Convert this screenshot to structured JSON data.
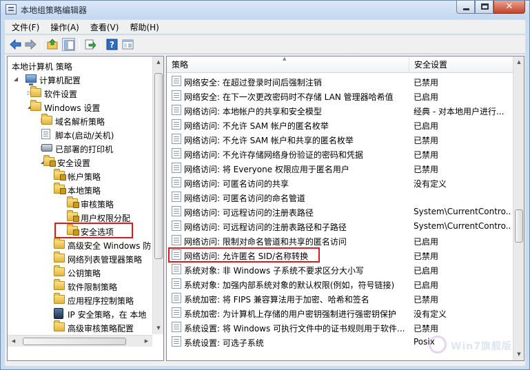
{
  "window": {
    "title": "本地组策略编辑器",
    "buttons": {
      "close_glyph": "✕"
    }
  },
  "menu": [
    "文件(F)",
    "操作(A)",
    "查看(V)",
    "帮助(H)"
  ],
  "toolbar": {
    "buttons": [
      "back-icon",
      "forward-icon",
      "up-folder-icon",
      "show-hide-tree-icon",
      "export-list-icon",
      "help-icon",
      "properties-icon"
    ]
  },
  "tree": {
    "items": [
      {
        "label": "本地计算机 策略",
        "icon": "none"
      },
      {
        "label": "计算机配置",
        "icon": "computer-icon",
        "expander": "◢"
      },
      {
        "label": "软件设置",
        "icon": "folder-icon",
        "expander": "▷"
      },
      {
        "label": "Windows 设置",
        "icon": "folder-icon",
        "expander": "◢"
      },
      {
        "label": "域名解析策略",
        "icon": "folder-icon",
        "expander": "▷"
      },
      {
        "label": "脚本(启动/关机)",
        "icon": "document-icon",
        "expander": ""
      },
      {
        "label": "已部署的打印机",
        "icon": "printer-icon",
        "expander": "▷"
      },
      {
        "label": "安全设置",
        "icon": "security-folder-icon",
        "expander": "◢"
      },
      {
        "label": "帐户策略",
        "icon": "security-folder-icon",
        "expander": "▷"
      },
      {
        "label": "本地策略",
        "icon": "security-folder-icon",
        "expander": "◢"
      },
      {
        "label": "审核策略",
        "icon": "security-folder-icon",
        "expander": "▷"
      },
      {
        "label": "用户权限分配",
        "icon": "security-folder-icon",
        "expander": ""
      },
      {
        "label": "安全选项",
        "icon": "security-folder-icon",
        "expander": "▷"
      },
      {
        "label": "高级安全 Windows 防",
        "icon": "folder-icon",
        "expander": "▷"
      },
      {
        "label": "网络列表管理器策略",
        "icon": "folder-icon",
        "expander": ""
      },
      {
        "label": "公钥策略",
        "icon": "folder-icon",
        "expander": "▷"
      },
      {
        "label": "软件限制策略",
        "icon": "folder-icon",
        "expander": "▷"
      },
      {
        "label": "应用程序控制策略",
        "icon": "folder-icon",
        "expander": "▷"
      },
      {
        "label": "IP 安全策略，在 本地",
        "icon": "ip-security-icon",
        "expander": "▷"
      },
      {
        "label": "高级审核策略配置",
        "icon": "folder-icon",
        "expander": "▷"
      }
    ]
  },
  "list": {
    "columns": {
      "policy": "策略",
      "setting": "安全设置"
    },
    "rows": [
      {
        "policy": "网络安全: 在超过登录时间后强制注销",
        "setting": "已禁用"
      },
      {
        "policy": "网络安全: 在下一次更改密码时不存储 LAN 管理器哈希值",
        "setting": "已启用"
      },
      {
        "policy": "网络访问: 本地帐户的共享和安全模型",
        "setting": "经典 - 对本地用户进行..."
      },
      {
        "policy": "网络访问: 不允许 SAM 帐户的匿名枚举",
        "setting": "已启用"
      },
      {
        "policy": "网络访问: 不允许 SAM 帐户和共享的匿名枚举",
        "setting": "已禁用"
      },
      {
        "policy": "网络访问: 不允许存储网络身份验证的密码和凭据",
        "setting": "已禁用"
      },
      {
        "policy": "网络访问: 将 Everyone 权限应用于匿名用户",
        "setting": "已禁用"
      },
      {
        "policy": "网络访问: 可匿名访问的共享",
        "setting": "没有定义"
      },
      {
        "policy": "网络访问: 可匿名访问的命名管道",
        "setting": ""
      },
      {
        "policy": "网络访问: 可远程访问的注册表路径",
        "setting": "System\\CurrentContro..."
      },
      {
        "policy": "网络访问: 可远程访问的注册表路径和子路径",
        "setting": "System\\CurrentContro..."
      },
      {
        "policy": "网络访问: 限制对命名管道和共享的匿名访问",
        "setting": "已启用"
      },
      {
        "policy": "网络访问: 允许匿名 SID/名称转换",
        "setting": "已禁用"
      },
      {
        "policy": "系统对象: 非 Windows 子系统不要求区分大小写",
        "setting": "已启用"
      },
      {
        "policy": "系统对象: 加强内部系统对象的默认权限(例如，符号链接)",
        "setting": "已启用"
      },
      {
        "policy": "系统加密: 将 FIPS 兼容算法用于加密、哈希和签名",
        "setting": "已禁用"
      },
      {
        "policy": "系统加密: 为计算机上存储的用户密钥强制进行强密钥保护",
        "setting": "没有定义"
      },
      {
        "policy": "系统设置: 将 Windows 可执行文件中的证书规则用于软件...",
        "setting": "已禁用"
      },
      {
        "policy": "系统设置: 可选子系统",
        "setting": "Posix"
      }
    ]
  }
}
